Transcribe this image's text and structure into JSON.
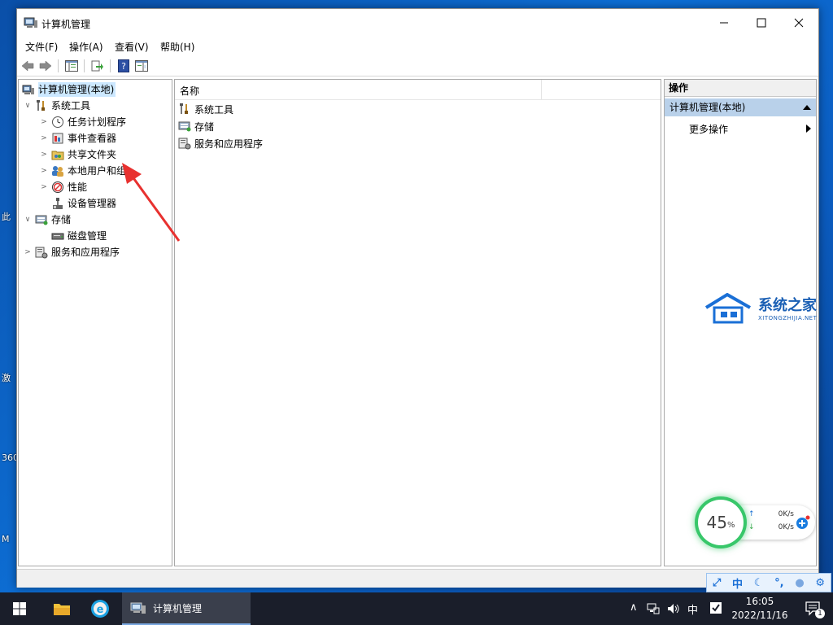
{
  "window": {
    "title": "计算机管理",
    "menu": [
      "文件(F)",
      "操作(A)",
      "查看(V)",
      "帮助(H)"
    ]
  },
  "tree": {
    "root": "计算机管理(本地)",
    "system_tools": "系统工具",
    "system_tools_children": [
      "任务计划程序",
      "事件查看器",
      "共享文件夹",
      "本地用户和组",
      "性能",
      "设备管理器"
    ],
    "storage": "存储",
    "storage_children": [
      "磁盘管理"
    ],
    "services": "服务和应用程序"
  },
  "list": {
    "column_name": "名称",
    "items": [
      "系统工具",
      "存储",
      "服务和应用程序"
    ]
  },
  "actions": {
    "header": "操作",
    "group": "计算机管理(本地)",
    "more": "更多操作"
  },
  "watermark": {
    "title": "系统之家",
    "subtitle": "XITONGZHIJIA.NET"
  },
  "speed_widget": {
    "percent": "45",
    "percent_sign": "%",
    "upload": "0K/s",
    "download": "0K/s"
  },
  "ime": {
    "lang": "中"
  },
  "taskbar": {
    "active_app": "计算机管理",
    "tray_lang": "中",
    "time": "16:05",
    "date": "2022/11/16",
    "notification_count": "1"
  },
  "desktop": {
    "labels": [
      "此",
      "激",
      "360",
      "M"
    ]
  },
  "colors": {
    "accent": "#0078d7",
    "selection": "#cce8ff",
    "action_group": "#b9d1ea",
    "gauge_green": "#38c76a",
    "annotation_red": "#e8312f"
  }
}
